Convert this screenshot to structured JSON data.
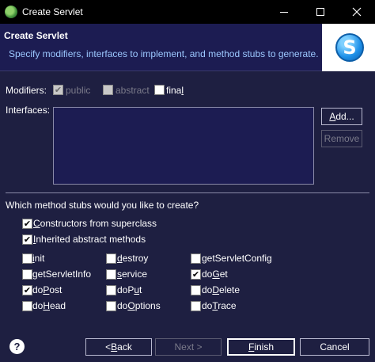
{
  "window": {
    "title": "Create Servlet"
  },
  "header": {
    "title": "Create Servlet",
    "description": "Specify modifiers, interfaces to implement, and method stubs to generate.",
    "logo_letter": "S"
  },
  "modifiers": {
    "label": "Modifiers:",
    "public": {
      "label": "public",
      "checked": true,
      "enabled": false
    },
    "abstract": {
      "label": "abstract",
      "checked": false,
      "enabled": false
    },
    "final": {
      "label_prefix": "fina",
      "label_mnemonic": "l",
      "checked": false,
      "enabled": true
    }
  },
  "interfaces": {
    "label": "Interfaces:",
    "add_prefix": "",
    "add_mnemonic": "A",
    "add_suffix": "dd...",
    "remove_label": "Remove"
  },
  "stubs": {
    "question": "Which method stubs would you like to create?",
    "constructors": {
      "mnemonic": "C",
      "rest": "onstructors from superclass",
      "checked": true
    },
    "inherited": {
      "mnemonic": "I",
      "rest": "nherited abstract methods",
      "checked": true
    },
    "methods": [
      {
        "pre": "",
        "mn": "i",
        "post": "nit",
        "checked": false
      },
      {
        "pre": "",
        "mn": "d",
        "post": "estroy",
        "checked": false
      },
      {
        "pre": "getServletConfig",
        "mn": "",
        "post": "",
        "checked": false
      },
      {
        "pre": "getServletInfo",
        "mn": "",
        "post": "",
        "checked": false
      },
      {
        "pre": "",
        "mn": "s",
        "post": "ervice",
        "checked": false
      },
      {
        "pre": "do",
        "mn": "G",
        "post": "et",
        "checked": true
      },
      {
        "pre": "do",
        "mn": "P",
        "post": "ost",
        "checked": true
      },
      {
        "pre": "doP",
        "mn": "u",
        "post": "t",
        "checked": false
      },
      {
        "pre": "do",
        "mn": "D",
        "post": "elete",
        "checked": false
      },
      {
        "pre": "do",
        "mn": "H",
        "post": "ead",
        "checked": false
      },
      {
        "pre": "do",
        "mn": "O",
        "post": "ptions",
        "checked": false
      },
      {
        "pre": "do",
        "mn": "T",
        "post": "race",
        "checked": false
      }
    ]
  },
  "footer": {
    "help_icon": "?",
    "back": {
      "pre": "< ",
      "mn": "B",
      "post": "ack"
    },
    "next": {
      "label": "Next >"
    },
    "finish": {
      "pre": "",
      "mn": "F",
      "post": "inish"
    },
    "cancel": {
      "label": "Cancel"
    }
  },
  "check_glyph": "✔"
}
